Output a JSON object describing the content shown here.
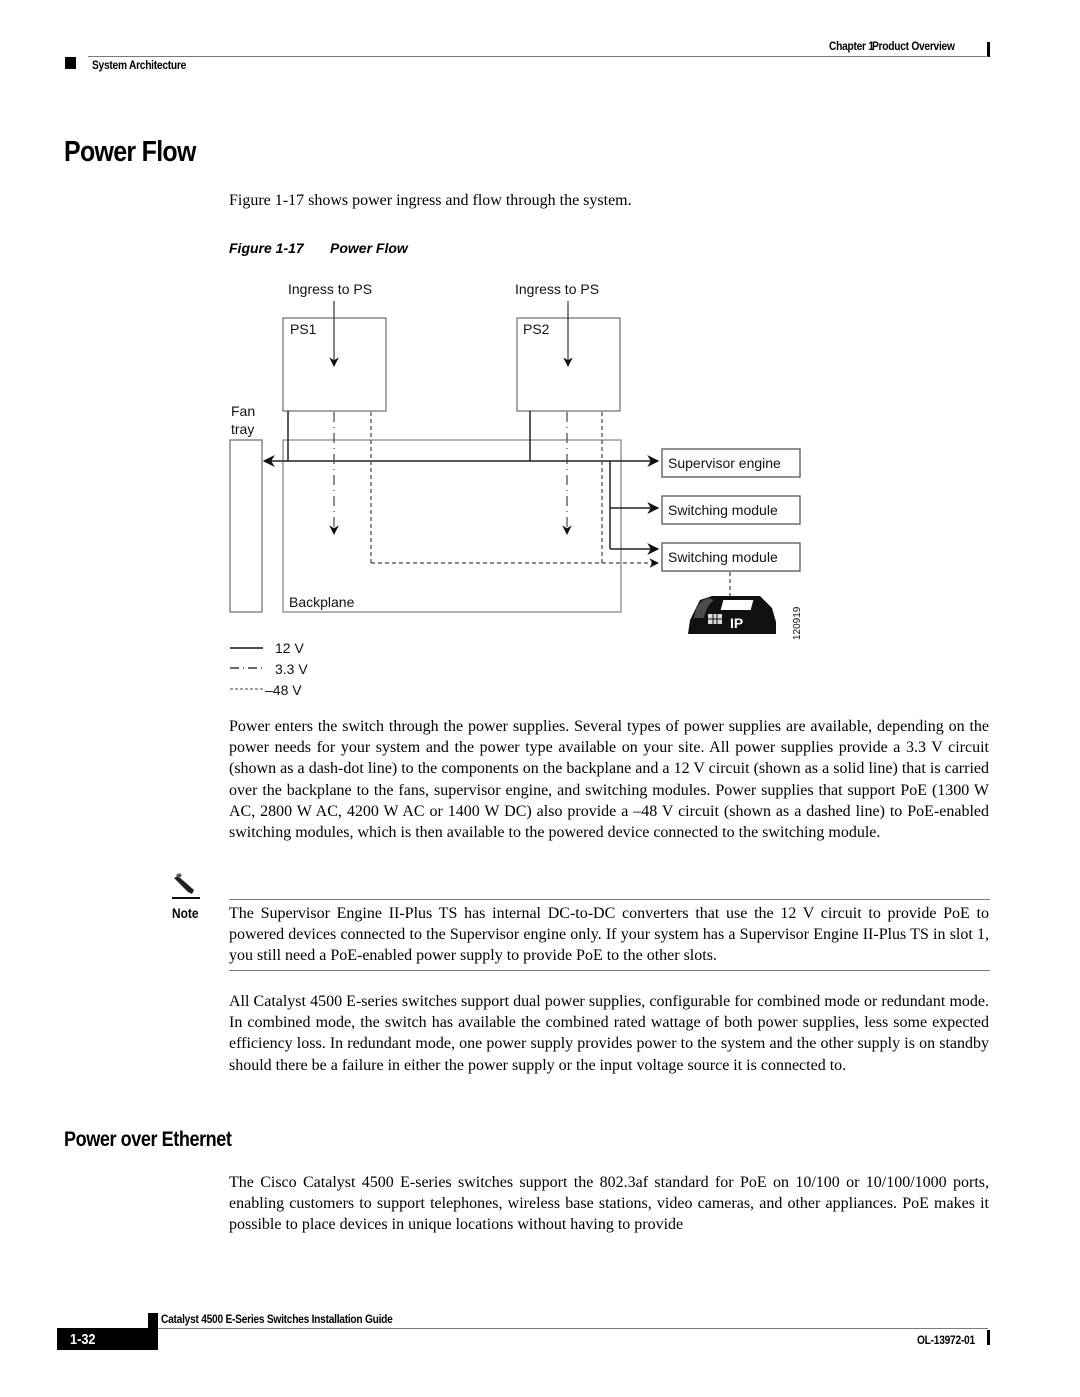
{
  "header": {
    "chapter": "Chapter 1",
    "chapter_title": "Product Overview",
    "section": "System Architecture"
  },
  "section1": {
    "title": "Power Flow",
    "intro": "Figure 1-17 shows power ingress and flow through the system."
  },
  "figure": {
    "number": "Figure 1-17",
    "title": "Power Flow",
    "labels": {
      "ingress1": "Ingress to PS",
      "ingress2": "Ingress to PS",
      "ps1": "PS1",
      "ps2": "PS2",
      "fan_line1": "Fan",
      "fan_line2": "tray",
      "backplane": "Backplane",
      "supervisor": "Supervisor engine",
      "switching1": "Switching module",
      "switching2": "Switching module",
      "phone_badge": "IP",
      "figure_id": "120919"
    },
    "legend": [
      {
        "style": "solid",
        "label": "12 V"
      },
      {
        "style": "dash-dot",
        "label": "3.3 V"
      },
      {
        "style": "dashed",
        "label": "–48 V"
      }
    ]
  },
  "body": {
    "para1": "Power enters the switch through the power supplies. Several types of power supplies are available, depending on the power needs for your system and the power type available on your site. All power supplies provide a 3.3 V circuit (shown as a dash-dot line) to the components on the backplane and a 12 V circuit (shown as a solid line) that is carried over the backplane to the fans, supervisor engine, and switching modules. Power supplies that support PoE (1300 W AC, 2800 W AC, 4200 W AC or 1400 W DC) also provide a –48 V circuit (shown as a dashed line) to PoE-enabled switching modules, which is then available to the powered device connected to the switching module.",
    "note_label": "Note",
    "note_text": "The Supervisor Engine II-Plus TS has internal DC-to-DC converters that use the 12 V circuit to provide PoE to powered devices connected to the Supervisor engine only. If your system has a Supervisor Engine II-Plus TS in slot 1, you still need a PoE-enabled power supply to provide PoE to the other slots.",
    "para2": "All Catalyst 4500 E-series switches support dual power supplies, configurable for combined mode or redundant mode. In combined mode, the switch has available the combined rated wattage of both power supplies, less some expected efficiency loss. In redundant mode, one power supply provides power to the system and the other supply is on standby should there be a failure in either the power supply or the input voltage source it is connected to."
  },
  "section2": {
    "title": "Power over Ethernet",
    "para": "The Cisco Catalyst 4500 E-series switches support the 802.3af standard for PoE on 10/100 or 10/100/1000 ports, enabling customers to support telephones, wireless base stations, video cameras, and other appliances. PoE makes it possible to place devices in unique locations without having to provide"
  },
  "footer": {
    "guide_title": "Catalyst 4500 E-Series Switches Installation Guide",
    "page_number": "1-32",
    "doc_id": "OL-13972-01"
  }
}
